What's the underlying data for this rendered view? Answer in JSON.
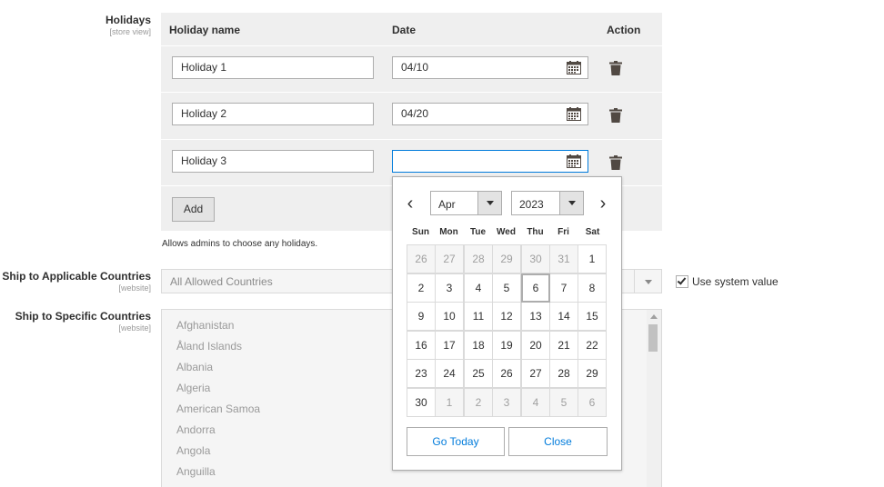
{
  "holidays": {
    "label": "Holidays",
    "scope": "[store view]",
    "columns": {
      "name": "Holiday name",
      "date": "Date",
      "action": "Action"
    },
    "rows": [
      {
        "name": "Holiday 1",
        "date": "04/10"
      },
      {
        "name": "Holiday 2",
        "date": "04/20"
      },
      {
        "name": "Holiday 3",
        "date": ""
      }
    ],
    "add_label": "Add",
    "note": "Allows admins to choose any holidays."
  },
  "ship_applicable": {
    "label": "Ship to Applicable Countries",
    "scope": "[website]",
    "value": "All Allowed Countries",
    "use_system_value_label": "Use system value",
    "use_system_value_checked": true
  },
  "ship_specific": {
    "label": "Ship to Specific Countries",
    "scope": "[website]",
    "countries": [
      "Afghanistan",
      "Åland Islands",
      "Albania",
      "Algeria",
      "American Samoa",
      "Andorra",
      "Angola",
      "Anguilla"
    ]
  },
  "datepicker": {
    "prev_icon": "‹",
    "next_icon": "›",
    "month": "Apr",
    "year": "2023",
    "weekdays": [
      "Sun",
      "Mon",
      "Tue",
      "Wed",
      "Thu",
      "Fri",
      "Sat"
    ],
    "weeks": [
      [
        "26",
        "27",
        "28",
        "29",
        "30",
        "31",
        "1"
      ],
      [
        "2",
        "3",
        "4",
        "5",
        "6",
        "7",
        "8"
      ],
      [
        "9",
        "10",
        "11",
        "12",
        "13",
        "14",
        "15"
      ],
      [
        "16",
        "17",
        "18",
        "19",
        "20",
        "21",
        "22"
      ],
      [
        "23",
        "24",
        "25",
        "26",
        "27",
        "28",
        "29"
      ],
      [
        "30",
        "1",
        "2",
        "3",
        "4",
        "5",
        "6"
      ]
    ],
    "today": "6",
    "go_today_label": "Go Today",
    "close_label": "Close"
  },
  "colors": {
    "accent": "#007bdb",
    "panel": "#efefef",
    "border": "#adadad"
  }
}
